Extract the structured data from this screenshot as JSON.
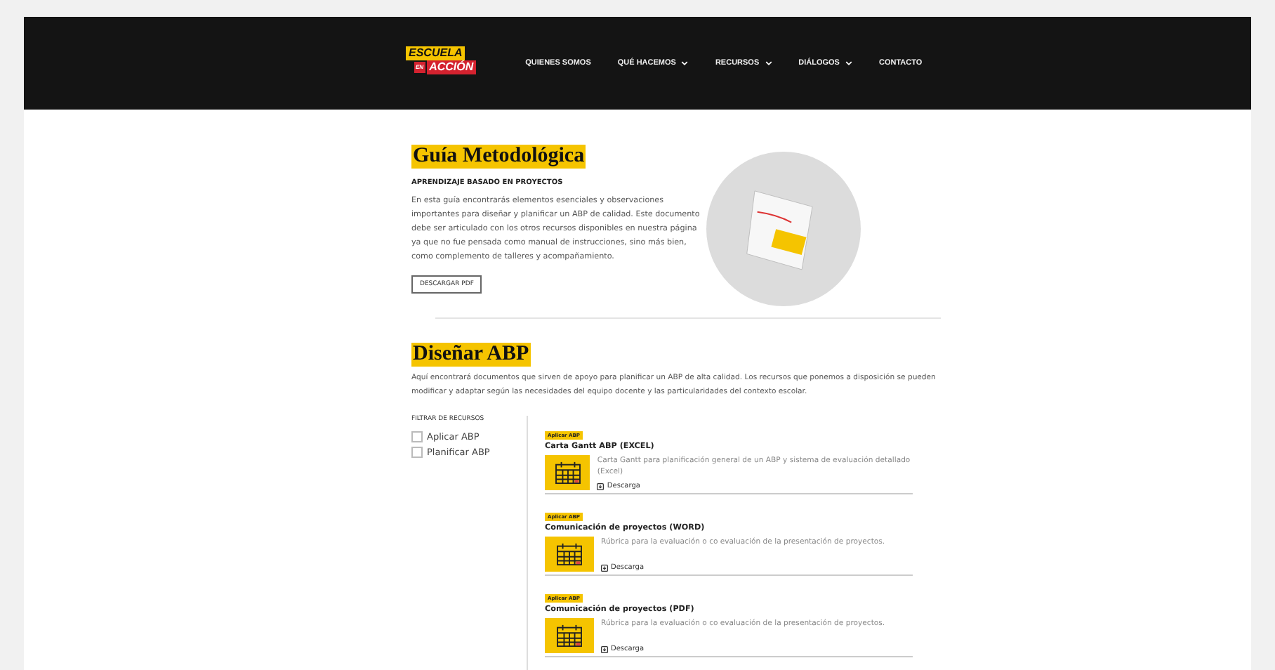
{
  "header": {
    "logo": {
      "top": "ESCUELA",
      "small": "EN",
      "bottom": "ACCIÓN"
    },
    "nav": [
      {
        "label": "QUIENES SOMOS",
        "dropdown": false
      },
      {
        "label": "QUÉ HACEMOS",
        "dropdown": true
      },
      {
        "label": "RECURSOS",
        "dropdown": true
      },
      {
        "label": "DIÁLOGOS",
        "dropdown": true
      },
      {
        "label": "CONTACTO",
        "dropdown": false
      }
    ]
  },
  "guide": {
    "title": "Guía Metodológica",
    "subtitle": "APRENDIZAJE BASADO EN PROYECTOS",
    "text": "En esta guía encontrarás elementos esenciales y observaciones importantes para diseñar y planificar un ABP de calidad. Este documento debe ser articulado con los otros recursos disponibles en nuestra página ya que no fue pensada como manual de instrucciones, sino más bien, como complemento de talleres y acompañamiento.",
    "button": "DESCARGAR PDF"
  },
  "design": {
    "title": "Diseñar ABP",
    "text": "Aquí encontrará documentos que sirven de apoyo para planificar un ABP de alta calidad. Los recursos que ponemos a disposición se pueden modificar y adaptar según las necesidades del equipo docente y las particularidades del contexto escolar."
  },
  "filter": {
    "title": "FILTRAR DE RECURSOS",
    "options": [
      {
        "label": "Aplicar ABP",
        "checked": false
      },
      {
        "label": "Planificar ABP",
        "checked": false
      }
    ]
  },
  "resources": [
    {
      "tag": "Aplicar ABP",
      "title": "Carta Gantt ABP (EXCEL)",
      "description": "Carta Gantt para planificación general de un ABP y sistema de evaluación detallado (Excel)",
      "link": "Descarga"
    },
    {
      "tag": "Aplicar ABP",
      "title": "Comunicación de proyectos (WORD)",
      "description": "Rúbrica para la evaluación o co evaluación de la presentación de proyectos.",
      "link": "Descarga"
    },
    {
      "tag": "Aplicar ABP",
      "title": "Comunicación de proyectos (PDF)",
      "description": "Rúbrica para la evaluación o co evaluación de la presentación de proyectos.",
      "link": "Descarga"
    }
  ]
}
